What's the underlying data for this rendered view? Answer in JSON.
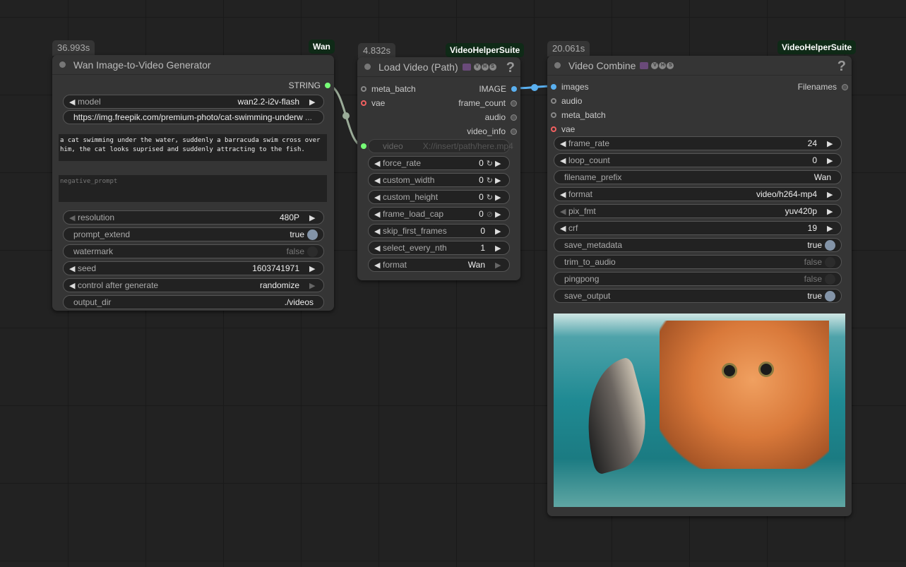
{
  "node_wan": {
    "time": "36.993s",
    "tag": "Wan",
    "title": "Wan Image-to-Video Generator",
    "output": "STRING",
    "url": "https://img.freepik.com/premium-photo/cat-swimming-underw",
    "url_ellipsis": "...",
    "prompt": "a cat swimming under the water, suddenly a barracuda swim cross over him, the cat looks suprised and suddenly attracting to the fish.",
    "negative_placeholder": "negative_prompt",
    "widgets": [
      {
        "label": "model",
        "value": "wan2.2-i2v-flash"
      },
      {
        "label": "resolution",
        "value": "480P"
      },
      {
        "label": "prompt_extend",
        "value": "true"
      },
      {
        "label": "watermark",
        "value": "false"
      },
      {
        "label": "seed",
        "value": "1603741971"
      },
      {
        "label": "control after generate",
        "value": "randomize"
      },
      {
        "label": "output_dir",
        "value": "./videos"
      }
    ]
  },
  "node_load": {
    "time": "4.832s",
    "tag": "VideoHelperSuite",
    "title": "Load Video (Path)",
    "help": "?",
    "inputs": [
      "meta_batch",
      "vae"
    ],
    "outputs": [
      "IMAGE",
      "frame_count",
      "audio",
      "video_info"
    ],
    "video_label": "video",
    "video_placeholder": "X://insert/path/here.mp4",
    "widgets": [
      {
        "label": "force_rate",
        "value": "0"
      },
      {
        "label": "custom_width",
        "value": "0"
      },
      {
        "label": "custom_height",
        "value": "0"
      },
      {
        "label": "frame_load_cap",
        "value": "0"
      },
      {
        "label": "skip_first_frames",
        "value": "0"
      },
      {
        "label": "select_every_nth",
        "value": "1"
      },
      {
        "label": "format",
        "value": "Wan"
      }
    ]
  },
  "node_combine": {
    "time": "20.061s",
    "tag": "VideoHelperSuite",
    "title": "Video Combine",
    "help": "?",
    "inputs": [
      "images",
      "audio",
      "meta_batch",
      "vae"
    ],
    "output": "Filenames",
    "widgets": [
      {
        "label": "frame_rate",
        "value": "24"
      },
      {
        "label": "loop_count",
        "value": "0"
      },
      {
        "label": "filename_prefix",
        "value": "Wan"
      },
      {
        "label": "format",
        "value": "video/h264-mp4"
      },
      {
        "label": "pix_fmt",
        "value": "yuv420p"
      },
      {
        "label": "crf",
        "value": "19"
      },
      {
        "label": "save_metadata",
        "value": "true"
      },
      {
        "label": "trim_to_audio",
        "value": "false"
      },
      {
        "label": "pingpong",
        "value": "false"
      },
      {
        "label": "save_output",
        "value": "true"
      }
    ]
  },
  "colors": {
    "link_image": "#5ab0f0",
    "link_string": "#9aab98",
    "node_bg": "#353535"
  }
}
